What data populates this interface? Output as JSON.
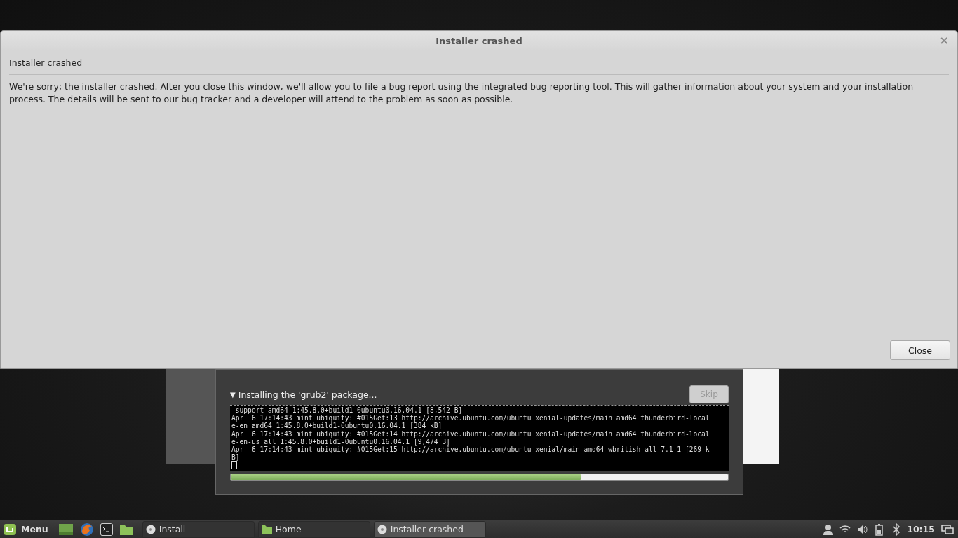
{
  "dialog": {
    "title": "Installer crashed",
    "close": "×",
    "heading": "Installer crashed",
    "message": "We're sorry; the installer crashed. After you close this window, we'll allow you to file a bug report using the integrated bug reporting tool. This will gather information about your system and your installation process. The details will be sent to our bug tracker and a developer will attend to the problem as soon as possible.",
    "button": "Close"
  },
  "progress_window": {
    "expander": "▼",
    "status": "Installing the 'grub2' package...",
    "skip_button": {
      "label": "Skip",
      "disabled": true
    },
    "terminal_lines": [
      "-support amd64 1:45.8.0+build1-0ubuntu0.16.04.1 [8,542 B]",
      "Apr  6 17:14:43 mint ubiquity: #015Get:13 http://archive.ubuntu.com/ubuntu xenial-updates/main amd64 thunderbird-local",
      "e-en amd64 1:45.8.0+build1-0ubuntu0.16.04.1 [384 kB]",
      "Apr  6 17:14:43 mint ubiquity: #015Get:14 http://archive.ubuntu.com/ubuntu xenial-updates/main amd64 thunderbird-local",
      "e-en-us all 1:45.8.0+build1-0ubuntu0.16.04.1 [9,474 B]",
      "Apr  6 17:14:43 mint ubiquity: #015Get:15 http://archive.ubuntu.com/ubuntu xenial/main amd64 wbritish all 7.1-1 [269 k",
      "B]"
    ],
    "level": 0.705
  },
  "taskbar": {
    "menu": "Menu",
    "launchers": [
      {
        "kind": "desktop"
      },
      {
        "kind": "browser"
      },
      {
        "kind": "terminal"
      },
      {
        "kind": "folder"
      }
    ],
    "windows": [
      {
        "label": "Install",
        "kind": "disc",
        "selected": false
      },
      {
        "label": "Home",
        "kind": "folder",
        "selected": false
      },
      {
        "label": "Installer crashed",
        "kind": "disc",
        "selected": true
      }
    ],
    "clock": "10:15"
  }
}
